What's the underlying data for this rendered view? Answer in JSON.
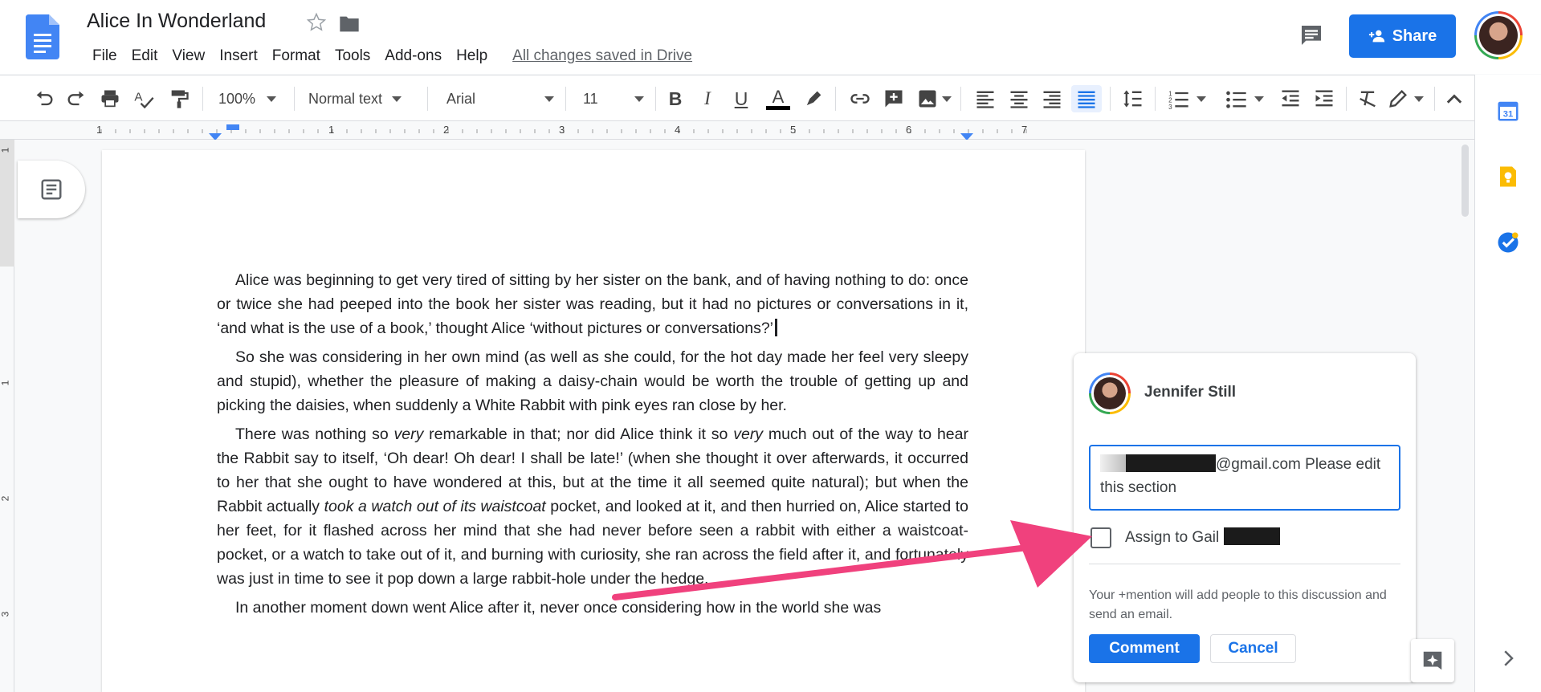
{
  "header": {
    "title": "Alice In Wonderland",
    "menu": [
      "File",
      "Edit",
      "View",
      "Insert",
      "Format",
      "Tools",
      "Add-ons",
      "Help"
    ],
    "saved_status": "All changes saved in Drive",
    "share_label": "Share"
  },
  "toolbar": {
    "zoom": "100%",
    "style": "Normal text",
    "font": "Arial",
    "size": "11",
    "text_color": "#000000"
  },
  "ruler": {
    "horizontal": [
      "1",
      "1",
      "2",
      "3",
      "4",
      "5",
      "6",
      "7"
    ],
    "vertical": [
      "1",
      "1",
      "2",
      "3"
    ]
  },
  "document": {
    "p1": "Alice was beginning to get very tired of sitting by her sister on the bank, and of having nothing to do: once or twice she had peeped into the book her sister was reading, but it had no pictures or conversations in it, ‘and what is the use of a book,’ thought Alice ‘without pictures or conversations?’",
    "p2": "So she was considering in her own mind (as well as she could, for the hot day made her feel very sleepy and stupid), whether the pleasure of making a daisy-chain would be worth the trouble of getting up and picking the daisies, when suddenly a White Rabbit with pink eyes ran close by her.",
    "p3_a": "There was nothing so ",
    "p3_b": "very",
    "p3_c": " remarkable in that; nor did Alice think it so ",
    "p3_d": "very",
    "p3_e": " much out of the way to hear the Rabbit say to itself, ‘Oh dear! Oh dear! I shall be late!’ (when she thought it over afterwards, it occurred to her that she ought to have wondered at this, but at the time it all seemed quite natural); but when the Rabbit actually ",
    "p3_f": "took a watch out of its waistcoat",
    "p3_g": " pocket, and looked at it, and then hurried on, Alice started to her feet, for it flashed across her mind that she had never before seen a rabbit with either a waistcoat-pocket, or a watch to take out of it, and burning with curiosity, she ran across the field after it, and fortunately was just in time to see it pop down a large rabbit-hole under the hedge.",
    "p4": "In another moment down went Alice after it, never once considering how in the world she was"
  },
  "comment": {
    "author": "Jennifer Still",
    "input_text": "@gmail.com Please edit this section",
    "assign_label": "Assign to Gail",
    "hint": "Your +mention will add people to this discussion and send an email.",
    "comment_label": "Comment",
    "cancel_label": "Cancel"
  },
  "colors": {
    "accent": "#1a73e8",
    "arrow": "#f0417d"
  }
}
